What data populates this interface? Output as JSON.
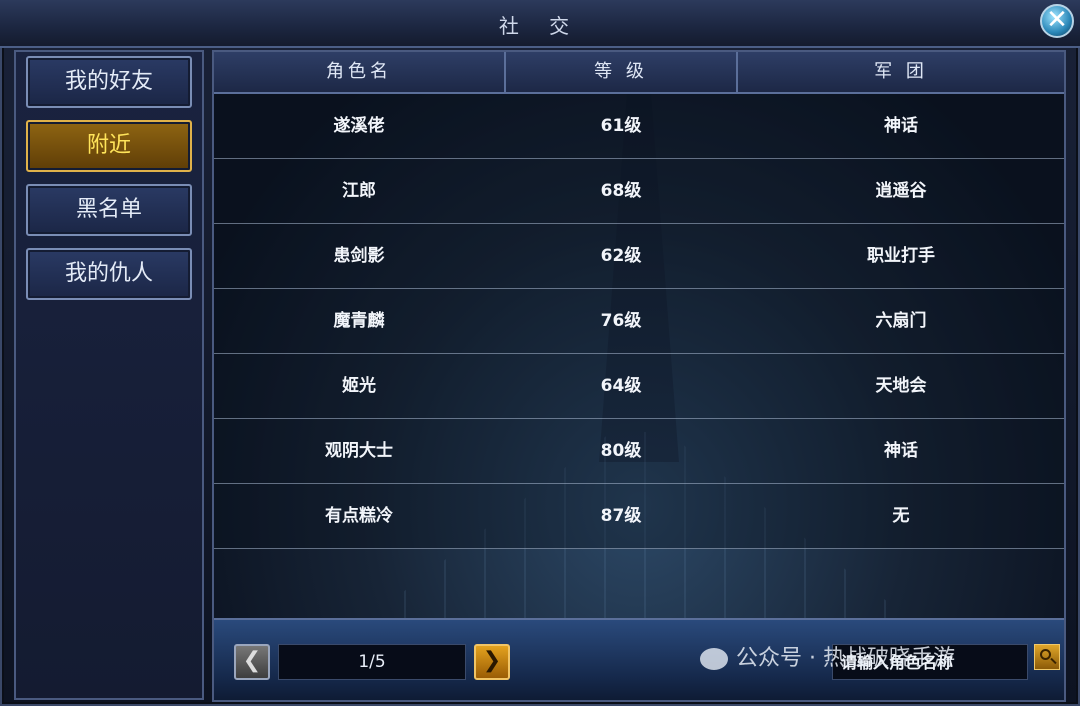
{
  "window": {
    "title": "社 交"
  },
  "sidebar": {
    "items": [
      {
        "label": "我的好友",
        "active": false
      },
      {
        "label": "附近",
        "active": true
      },
      {
        "label": "黑名单",
        "active": false
      },
      {
        "label": "我的仇人",
        "active": false
      }
    ]
  },
  "table": {
    "columns": [
      "角色名",
      "等 级",
      "军 团"
    ],
    "rows": [
      {
        "name": "遂溪佬",
        "level": "61级",
        "guild": "神话"
      },
      {
        "name": "江郎",
        "level": "68级",
        "guild": "逍遥谷"
      },
      {
        "name": "患剑影",
        "level": "62级",
        "guild": "职业打手"
      },
      {
        "name": "魔青麟",
        "level": "76级",
        "guild": "六扇门"
      },
      {
        "name": "姬光",
        "level": "64级",
        "guild": "天地会"
      },
      {
        "name": "观阴大士",
        "level": "80级",
        "guild": "神话"
      },
      {
        "name": "有点糕冷",
        "level": "87级",
        "guild": "无"
      }
    ]
  },
  "pagination": {
    "page_text": "1/5"
  },
  "search": {
    "placeholder": "请输入角色名称"
  },
  "watermark": {
    "text": "公众号 · 热战破晓手游"
  },
  "colors": {
    "active_tab_text": "#ffe45a",
    "accent_gold": "#e3a21e"
  }
}
